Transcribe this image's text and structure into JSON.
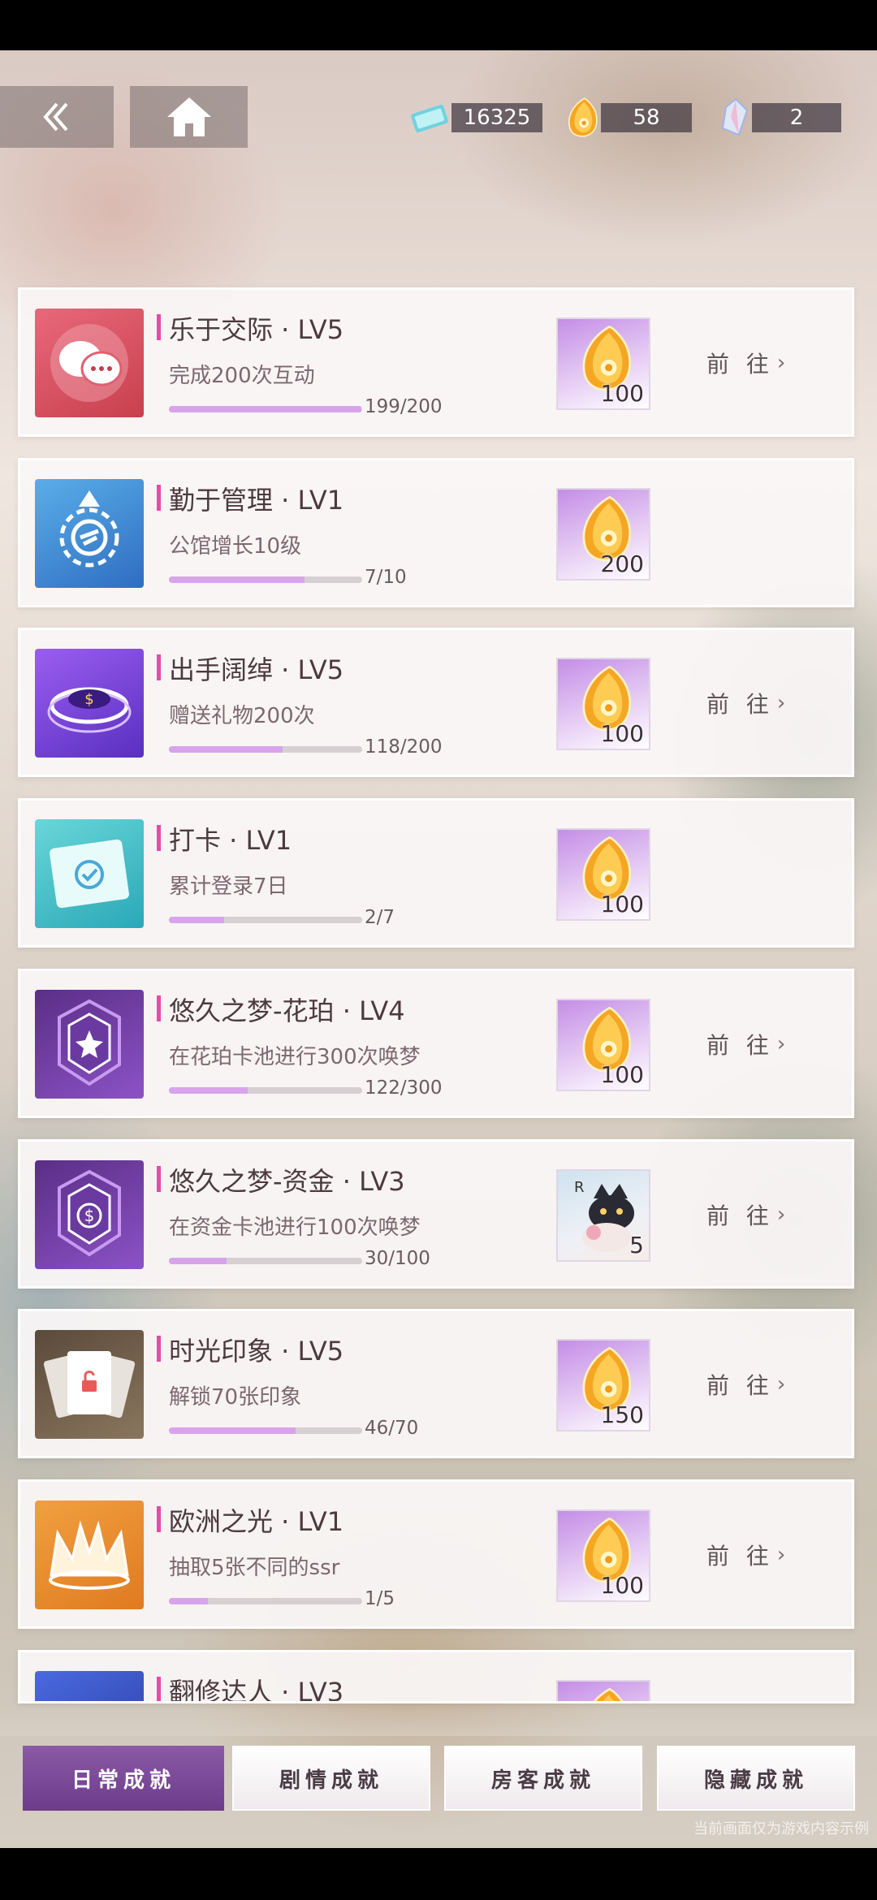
{
  "header": {
    "back_icon": "double-chevron-left-icon",
    "home_icon": "home-icon",
    "currencies": [
      {
        "icon": "ticket-icon",
        "value": "16325"
      },
      {
        "icon": "amber-gem-icon",
        "value": "58"
      },
      {
        "icon": "crystal-icon",
        "value": "2"
      }
    ]
  },
  "achievements": [
    {
      "title": "乐于交际 · LV5",
      "desc": "完成200次互动",
      "progress_text": "199/200",
      "progress": 0.995,
      "reward_count": "100",
      "reward_icon": "amber-gem-icon",
      "action": "前 往",
      "icon": "chat-bubbles-icon",
      "colors": [
        "#e8687a",
        "#c8404e"
      ]
    },
    {
      "title": "勤于管理 · LV1",
      "desc": "公馆增长10级",
      "progress_text": "7/10",
      "progress": 0.7,
      "reward_count": "200",
      "reward_icon": "amber-gem-icon",
      "action": "",
      "icon": "gear-emblem-icon",
      "colors": [
        "#5aaee8",
        "#2f6dc2"
      ]
    },
    {
      "title": "出手阔绰 · LV5",
      "desc": "赠送礼物200次",
      "progress_text": "118/200",
      "progress": 0.59,
      "reward_count": "100",
      "reward_icon": "amber-gem-icon",
      "action": "前 往",
      "icon": "coin-ring-icon",
      "colors": [
        "#9a5ef0",
        "#5a2fc0"
      ]
    },
    {
      "title": "打卡 · LV1",
      "desc": "累计登录7日",
      "progress_text": "2/7",
      "progress": 0.286,
      "reward_count": "100",
      "reward_icon": "amber-gem-icon",
      "action": "",
      "icon": "calendar-check-icon",
      "colors": [
        "#6ad6d8",
        "#2aa8b8"
      ]
    },
    {
      "title": "悠久之梦-花珀 · LV4",
      "desc": "在花珀卡池进行300次唤梦",
      "progress_text": "122/300",
      "progress": 0.407,
      "reward_count": "100",
      "reward_icon": "amber-gem-icon",
      "action": "前 往",
      "icon": "star-badge-icon",
      "colors": [
        "#5a2f86",
        "#8c52c6"
      ]
    },
    {
      "title": "悠久之梦-资金 · LV3",
      "desc": "在资金卡池进行100次唤梦",
      "progress_text": "30/100",
      "progress": 0.3,
      "reward_count": "5",
      "reward_icon": "cat-card-icon",
      "action": "前 往",
      "icon": "dollar-badge-icon",
      "colors": [
        "#5a2f86",
        "#8c52c6"
      ]
    },
    {
      "title": "时光印象 · LV5",
      "desc": "解锁70张印象",
      "progress_text": "46/70",
      "progress": 0.657,
      "reward_count": "150",
      "reward_icon": "amber-gem-icon",
      "action": "前 往",
      "icon": "card-stack-icon",
      "colors": [
        "#5a4a3a",
        "#8a765e"
      ]
    },
    {
      "title": "欧洲之光 · LV1",
      "desc": "抽取5张不同的ssr",
      "progress_text": "1/5",
      "progress": 0.2,
      "reward_count": "100",
      "reward_icon": "amber-gem-icon",
      "action": "前 往",
      "icon": "crown-icon",
      "colors": [
        "#f0a040",
        "#e07a20"
      ]
    },
    {
      "title": "翻修达人 · LV3",
      "desc": "",
      "progress_text": "",
      "progress": 0,
      "reward_count": "",
      "reward_icon": "amber-gem-icon",
      "action": "",
      "icon": "hammer-icon",
      "colors": [
        "#4a6ae0",
        "#2a3aa0"
      ]
    }
  ],
  "tabs": [
    {
      "label": "日常成就",
      "active": true
    },
    {
      "label": "剧情成就",
      "active": false
    },
    {
      "label": "房客成就",
      "active": false
    },
    {
      "label": "隐藏成就",
      "active": false
    }
  ],
  "watermark": "当前画面仅为游戏内容示例"
}
